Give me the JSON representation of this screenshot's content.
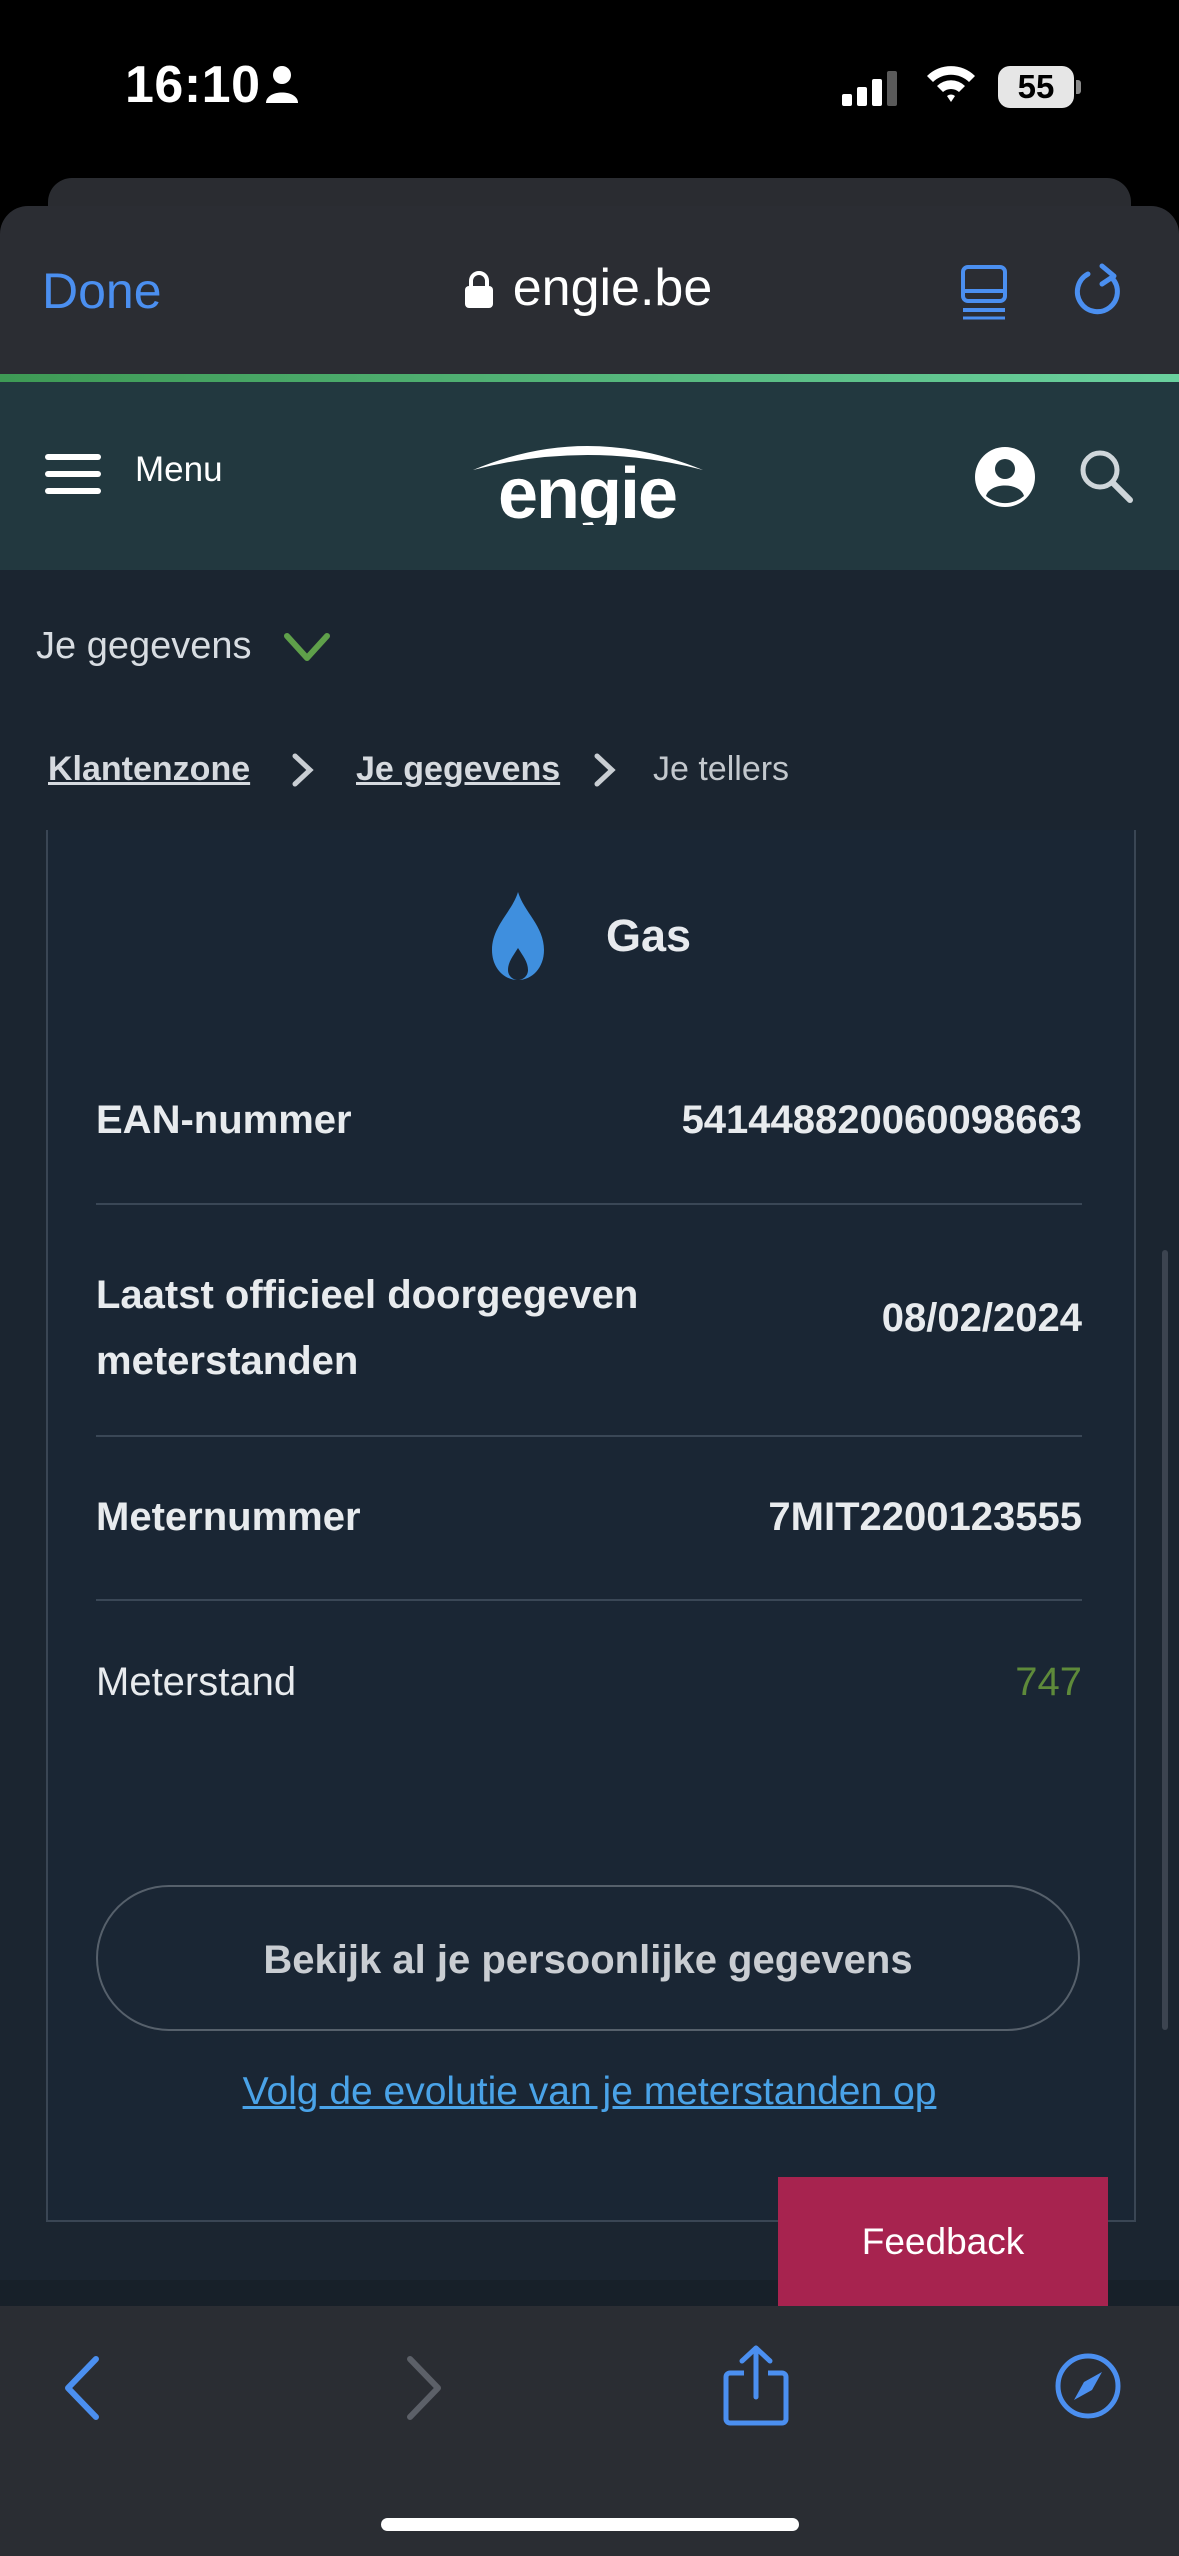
{
  "status_bar": {
    "time": "16:10",
    "battery": "55"
  },
  "browser": {
    "done_label": "Done",
    "url": "engie.be"
  },
  "site_header": {
    "menu_label": "Menu",
    "logo_text": "engie"
  },
  "section_dropdown": {
    "label": "Je gegevens"
  },
  "breadcrumb": {
    "items": [
      "Klantenzone",
      "Je gegevens",
      "Je tellers"
    ]
  },
  "meter_card": {
    "title": "Gas",
    "rows": [
      {
        "label": "EAN-nummer",
        "value": "541448820060098663"
      },
      {
        "label_line1": "Laatst officieel doorgegeven",
        "label_line2": "meterstanden",
        "value": "08/02/2024"
      },
      {
        "label": "Meternummer",
        "value": "7MIT2200123555"
      },
      {
        "label": "Meterstand",
        "value": "747"
      }
    ],
    "view_all_button": "Bekijk al je persoonlijke gegevens",
    "evolution_link": "Volg de evolutie van je meterstanden op"
  },
  "feedback_label": "Feedback",
  "colors": {
    "accent_blue": "#4b8ff0",
    "meterstand_green": "#5e8a3a",
    "feedback": "#a7234f",
    "header_bg": "#22383f"
  }
}
